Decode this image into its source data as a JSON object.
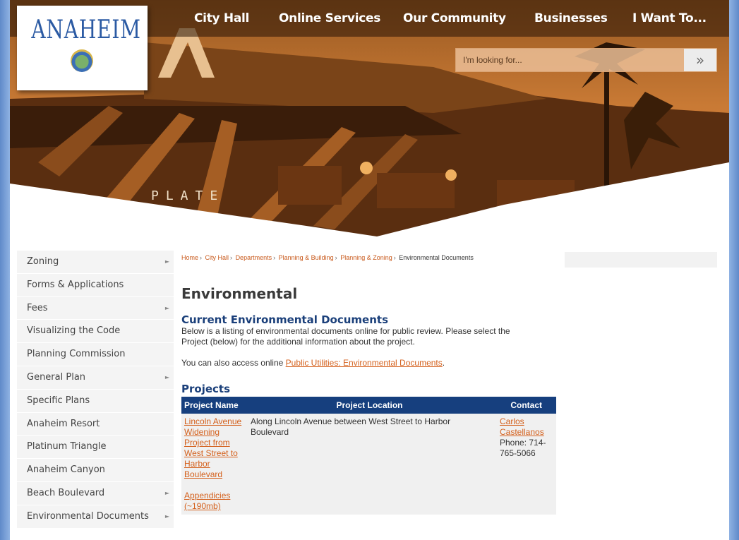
{
  "header": {
    "logo_text": "ANAHEIM",
    "nav": [
      "City Hall",
      "Online Services",
      "Our Community",
      "Businesses",
      "I Want To..."
    ],
    "search_placeholder": "I'm looking for...",
    "search_button_icon": "double-chevron-right-icon",
    "search_button_glyph": "»",
    "banner_text": "PLATE"
  },
  "sidebar": {
    "items": [
      {
        "label": "Zoning",
        "has_submenu": true
      },
      {
        "label": "Forms & Applications",
        "has_submenu": false
      },
      {
        "label": "Fees",
        "has_submenu": true
      },
      {
        "label": "Visualizing the Code",
        "has_submenu": false
      },
      {
        "label": "Planning Commission",
        "has_submenu": false
      },
      {
        "label": "General Plan",
        "has_submenu": true
      },
      {
        "label": "Specific Plans",
        "has_submenu": false
      },
      {
        "label": "Anaheim Resort",
        "has_submenu": false
      },
      {
        "label": "Platinum Triangle",
        "has_submenu": false
      },
      {
        "label": "Anaheim Canyon",
        "has_submenu": false
      },
      {
        "label": "Beach Boulevard",
        "has_submenu": true
      },
      {
        "label": "Environmental Documents",
        "has_submenu": true
      }
    ],
    "arrow_glyph": "►"
  },
  "breadcrumb": {
    "items": [
      "Home",
      "City Hall",
      "Departments",
      "Planning & Building",
      "Planning & Zoning"
    ],
    "current": "Environmental Documents",
    "separator": "›"
  },
  "main": {
    "title": "Environmental",
    "section_heading": "Current Environmental Documents",
    "intro": "Below is a listing of environmental documents online for public review. Please select the Project (below) for the additional information about the project.",
    "access_prefix": "You can also access online ",
    "access_link": "Public Utilities: Environmental Documents",
    "access_suffix": ".",
    "projects_heading": "Projects"
  },
  "table": {
    "headers": [
      "Project Name",
      "Project Location",
      "Contact"
    ],
    "rows": [
      {
        "name_link": "Lincoln Avenue Widening Project from West Street to Harbor Boulevard",
        "appendix_link": "Appendicies (~190mb)",
        "location": "Along Lincoln Avenue between West Street to Harbor Boulevard",
        "contact_link": "Carlos Castellanos",
        "phone": "Phone: 714-765-5066"
      }
    ]
  },
  "colors": {
    "nav_text": "#ffffff",
    "link": "#d4601c",
    "heading_blue": "#1a3f7a",
    "table_header": "#163f7e",
    "frame": "#7a9fd4"
  }
}
